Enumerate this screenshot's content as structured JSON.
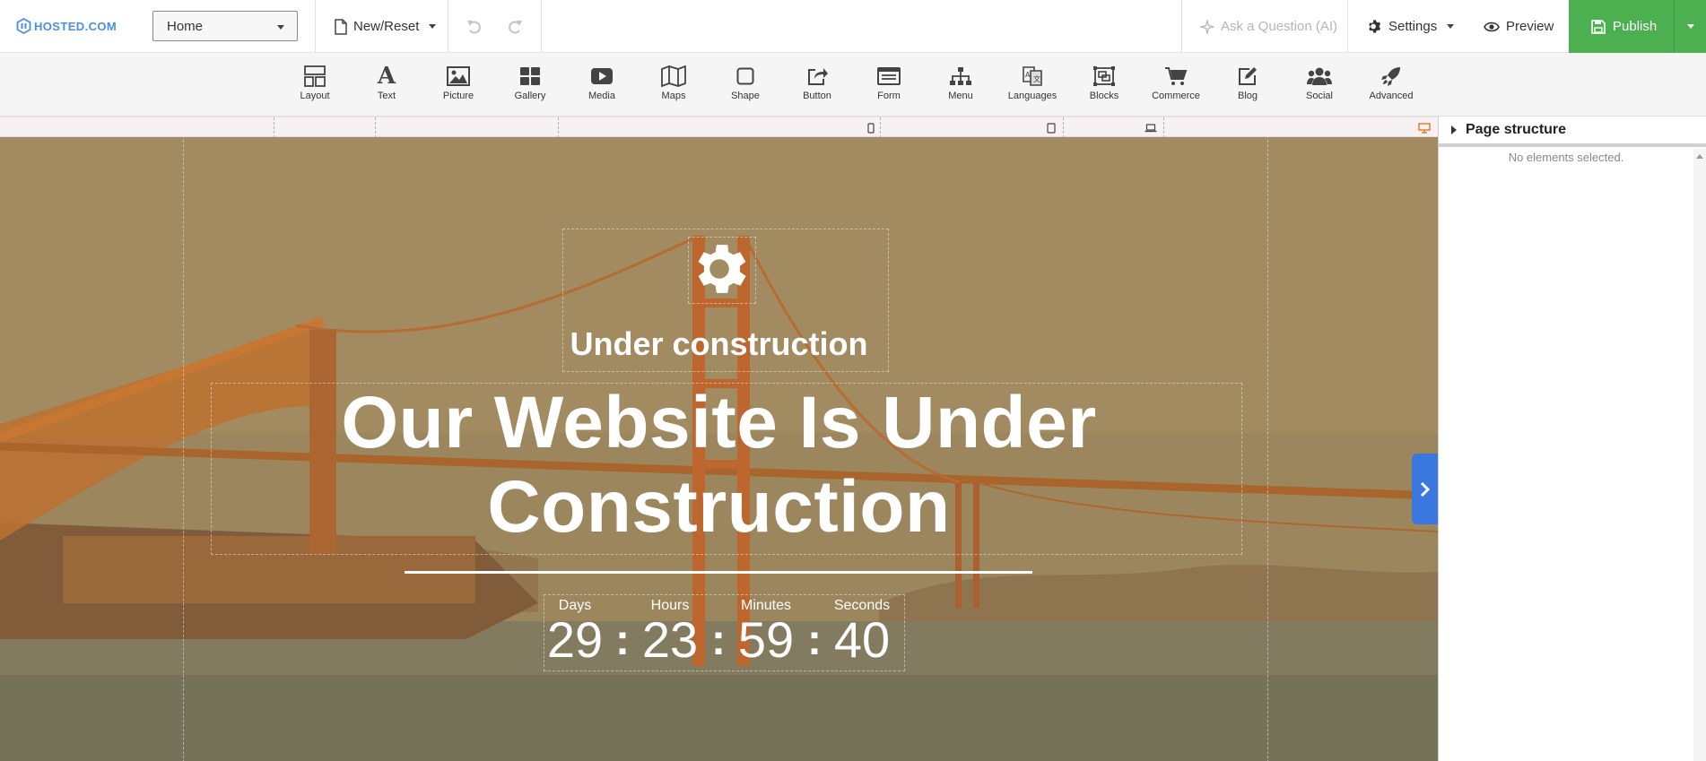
{
  "app": {
    "logo_text": "HOSTED.COM",
    "brand_color": "#4a90e2",
    "accent_green": "#4caf50",
    "accent_blue": "#3a78e0"
  },
  "topbar": {
    "page_select": {
      "value": "Home"
    },
    "new_reset": "New/Reset",
    "undo_icon": "undo-icon",
    "redo_icon": "redo-icon",
    "ask_ai": "Ask a Question (AI)",
    "settings": "Settings",
    "preview": "Preview",
    "publish": "Publish"
  },
  "widgets": [
    {
      "label": "Layout",
      "icon": "layout-icon"
    },
    {
      "label": "Text",
      "icon": "text-icon"
    },
    {
      "label": "Picture",
      "icon": "picture-icon"
    },
    {
      "label": "Gallery",
      "icon": "gallery-icon"
    },
    {
      "label": "Media",
      "icon": "media-icon"
    },
    {
      "label": "Maps",
      "icon": "maps-icon"
    },
    {
      "label": "Shape",
      "icon": "shape-icon"
    },
    {
      "label": "Button",
      "icon": "button-icon"
    },
    {
      "label": "Form",
      "icon": "form-icon"
    },
    {
      "label": "Menu",
      "icon": "menu-icon"
    },
    {
      "label": "Languages",
      "icon": "languages-icon"
    },
    {
      "label": "Blocks",
      "icon": "blocks-icon"
    },
    {
      "label": "Commerce",
      "icon": "cart-icon"
    },
    {
      "label": "Blog",
      "icon": "blog-icon"
    },
    {
      "label": "Social",
      "icon": "social-icon"
    },
    {
      "label": "Advanced",
      "icon": "rocket-icon"
    }
  ],
  "canvas": {
    "subtitle": "Under construction",
    "headline_line1": "Our Website Is Under",
    "headline_line2": "Construction",
    "countdown": {
      "labels": {
        "days": "Days",
        "hours": "Hours",
        "minutes": "Minutes",
        "seconds": "Seconds"
      },
      "values": {
        "days": "29",
        "hours": "23",
        "minutes": "59",
        "seconds": "40"
      },
      "separator": ":"
    }
  },
  "panel": {
    "title": "Page structure",
    "empty_message": "No elements selected."
  }
}
